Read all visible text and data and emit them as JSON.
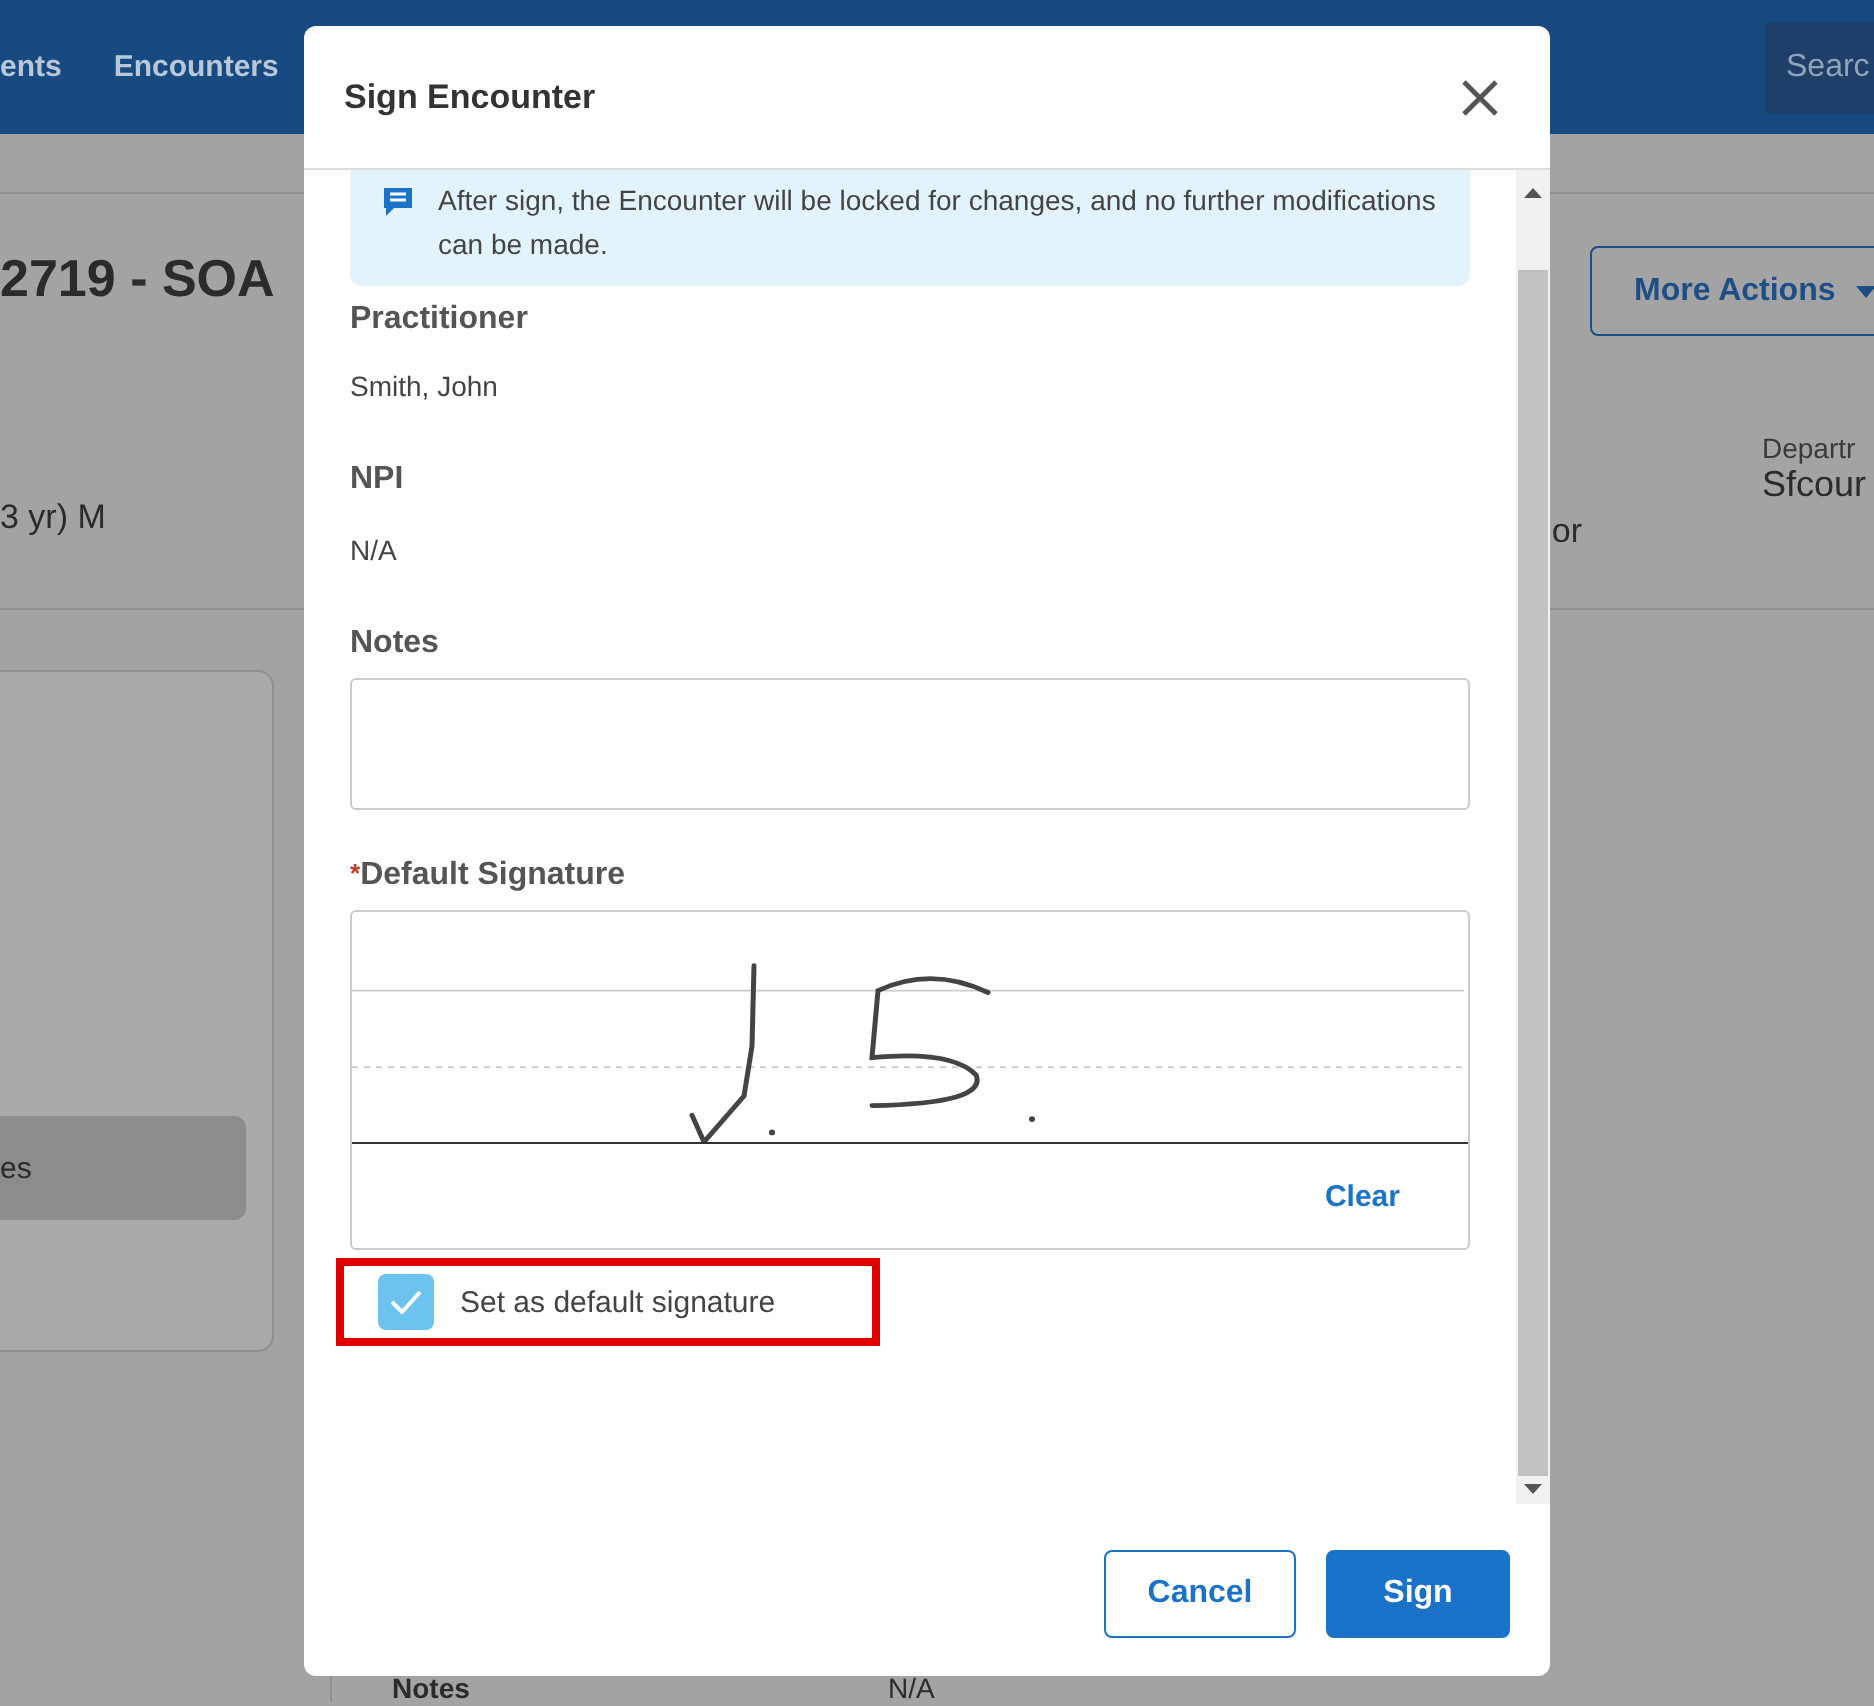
{
  "nav": {
    "items": [
      {
        "label": "ents",
        "selected": false
      },
      {
        "label": "Encounters",
        "selected": false
      }
    ],
    "search": {
      "placeholder": "Searc"
    }
  },
  "header": {
    "title": "2719 - SOA",
    "patient_info": "3 yr) M",
    "more_actions": "More Actions",
    "department": {
      "label": "Departr",
      "value": "Sfcour"
    },
    "column_3": "or"
  },
  "sidebar": {
    "items": [
      {
        "label": "es",
        "selected": true
      }
    ]
  },
  "details": [
    {
      "label": "Notes",
      "value": "N/A"
    }
  ],
  "dialog": {
    "title": "Sign Encounter",
    "alert": "After sign, the Encounter will be locked for changes, and no further modifications can be made.",
    "fields": [
      {
        "label": "Practitioner",
        "value": "Smith, John"
      },
      {
        "label": "NPI",
        "value": "N/A"
      }
    ],
    "notes": {
      "label": "Notes"
    },
    "signature": {
      "label": "Default Signature",
      "required_mark": "*",
      "clear": "Clear"
    },
    "default_checkbox": {
      "label": "Set as default signature",
      "checked": true,
      "highlighted": true
    },
    "buttons": [
      {
        "label": "Cancel",
        "kind": "secondary"
      },
      {
        "label": "Sign",
        "kind": "primary"
      }
    ]
  }
}
